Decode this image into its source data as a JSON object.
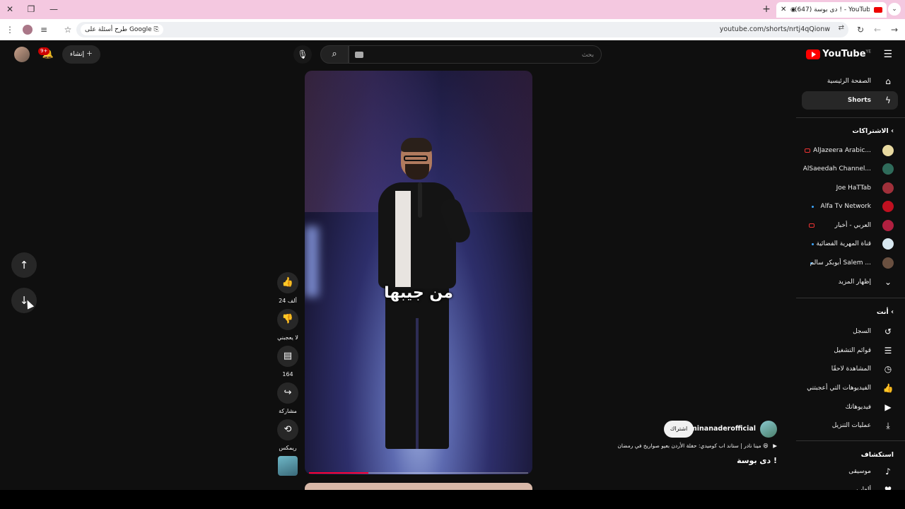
{
  "browser": {
    "tab_title": "(647) دى بوسة ! - YouTube",
    "new_tab_icon": "+",
    "url": "youtube.com/shorts/nrtj4qQionw",
    "search_chip": "طرح أسئلة على Google"
  },
  "header": {
    "logo_text": "YouTube",
    "logo_region": "YE",
    "search_placeholder": "بحث",
    "create_label": "إنشاء",
    "notif_badge": "9+"
  },
  "sidebar": {
    "home": "الصفحة الرئيسية",
    "shorts": "Shorts",
    "subs_header": "الاشتراكات",
    "channels": [
      {
        "name": "AlJazeera Arabic...",
        "avatar": "#e8d9a0"
      },
      {
        "name": "AlSaeedah Channel...",
        "avatar": "#2f6b5a"
      },
      {
        "name": "Joe HaTTab",
        "avatar": "#a0303a"
      },
      {
        "name": "Alfa Tv Network",
        "avatar": "#c01020"
      },
      {
        "name": "العربي - أخبار",
        "avatar": "#b02040"
      },
      {
        "name": "قناة المهرية الفضائية",
        "avatar": "#d8e8f0"
      },
      {
        "name": "أبوبكر سالم Salem ...",
        "avatar": "#6a5040"
      }
    ],
    "show_more": "إظهار المزيد",
    "you_header": "أنت",
    "you_items": [
      "السجل",
      "قوائم التشغيل",
      "المشاهدة لاحقًا",
      "الفيديوهات التي أعجبتني",
      "فيديوهاتك",
      "عمليات التنزيل"
    ],
    "explore_header": "استكشاف",
    "explore_items": [
      "موسيقى",
      "ألعاب"
    ]
  },
  "video": {
    "caption": "من جيبها",
    "progress": 0.27
  },
  "actions": {
    "likes": "24 ألف",
    "dislike_label": "لا يعجبني",
    "comments": "164",
    "share_label": "مشاركة",
    "remix_label": "ريمكس"
  },
  "meta": {
    "channel_handle": "@minanaderofficial",
    "subscribe_label": "اشتراك",
    "description": "مينا نادر | ستاند اب كوميدي: حفلة الأردن بعيو صواريخ في رمضان 😆",
    "title": "دى بوسة !"
  }
}
